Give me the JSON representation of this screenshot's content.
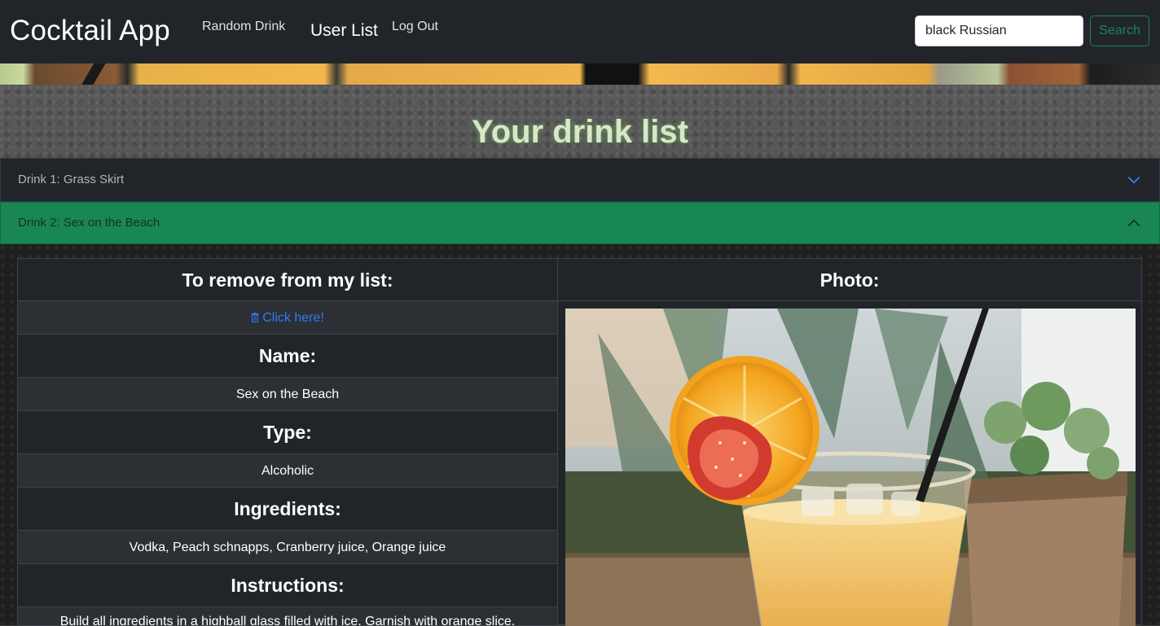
{
  "navbar": {
    "brand": "Cocktail App",
    "links": {
      "random_drink": "Random Drink",
      "user_list": "User List",
      "log_out": "Log Out"
    },
    "search": {
      "value": "black Russian",
      "button_label": "Search"
    }
  },
  "page": {
    "title": "Your drink list"
  },
  "accordion": {
    "items": [
      {
        "label": "Drink 1: Grass Skirt",
        "expanded": false
      },
      {
        "label": "Drink 2: Sex on the Beach",
        "expanded": true
      }
    ]
  },
  "details": {
    "remove_heading": "To remove from my list:",
    "remove_link": "Click here!",
    "name_heading": "Name:",
    "name_value": "Sex on the Beach",
    "type_heading": "Type:",
    "type_value": "Alcoholic",
    "ingredients_heading": "Ingredients:",
    "ingredients_value": "Vodka, Peach schnapps, Cranberry juice, Orange juice",
    "instructions_heading": "Instructions:",
    "instructions_value": "Build all ingredients in a highball glass filled with ice. Garnish with orange slice.",
    "photo_heading": "Photo:"
  },
  "colors": {
    "navbar_bg": "#212529",
    "accent_green": "#198754",
    "link_blue": "#2f7bf5",
    "table_bg": "#212529"
  },
  "icons": {
    "trash": "trash-icon",
    "chevron_down": "chevron-down-icon",
    "chevron_up": "chevron-up-icon"
  }
}
